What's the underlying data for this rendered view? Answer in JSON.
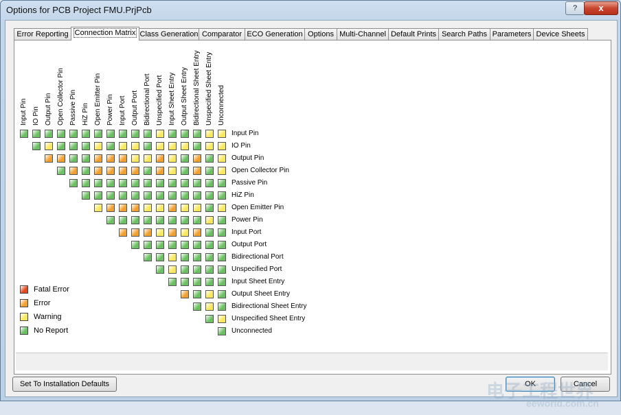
{
  "window": {
    "title": "Options for PCB Project FMU.PrjPcb",
    "help_label": "?",
    "close_label": "x"
  },
  "tabs": [
    "Error Reporting",
    "Connection Matrix",
    "Class Generation",
    "Comparator",
    "ECO Generation",
    "Options",
    "Multi-Channel",
    "Default Prints",
    "Search Paths",
    "Parameters",
    "Device Sheets"
  ],
  "active_tab": 1,
  "matrix": {
    "columns": [
      "Input Pin",
      "IO Pin",
      "Output Pin",
      "Open Collector Pin",
      "Passive Pin",
      "HiZ Pin",
      "Open Emitter Pin",
      "Power Pin",
      "Input Port",
      "Output Port",
      "Bidirectional Port",
      "Unspecified Port",
      "Input Sheet Entry",
      "Output Sheet Entry",
      "Bidirectional Sheet Entry",
      "Unspecified Sheet Entry",
      "Unconnected"
    ],
    "rows": [
      "Input Pin",
      "IO Pin",
      "Output Pin",
      "Open Collector Pin",
      "Passive Pin",
      "HiZ Pin",
      "Open Emitter Pin",
      "Power Pin",
      "Input Port",
      "Output Port",
      "Bidirectional Port",
      "Unspecified Port",
      "Input Sheet Entry",
      "Output Sheet Entry",
      "Bidirectional Sheet Entry",
      "Unspecified Sheet Entry",
      "Unconnected"
    ],
    "cells": [
      "NNNNNNNNNNNWNNNWW",
      " NWNNNWNWWNWWWNWW",
      "  EENNEEEWWEWNENW",
      "   NENEEEENEWNENW",
      "    NNNNNNNNNNNNN",
      "     NNNNNNNNNNNN",
      "      WEEEWWEWWNW",
      "       NNNNNNNNWN",
      "        EEEWEWENN",
      "         NNNNNNNN",
      "          NNWNNNN",
      "           NWNNNN",
      "            NNNNN",
      "             ENWN",
      "              NWN",
      "               NW",
      "                N"
    ]
  },
  "legend": [
    {
      "key": "F",
      "label": "Fatal Error",
      "color": "#e04a1c"
    },
    {
      "key": "E",
      "label": "Error",
      "color": "#f0a030"
    },
    {
      "key": "W",
      "label": "Warning",
      "color": "#f8e860"
    },
    {
      "key": "N",
      "label": "No Report",
      "color": "#6cbf62"
    }
  ],
  "buttons": {
    "defaults": "Set To Installation Defaults",
    "ok": "OK",
    "cancel": "Cancel"
  },
  "watermark": {
    "line1": "电子工程世界",
    "line2": "eeworld.com.cn"
  }
}
